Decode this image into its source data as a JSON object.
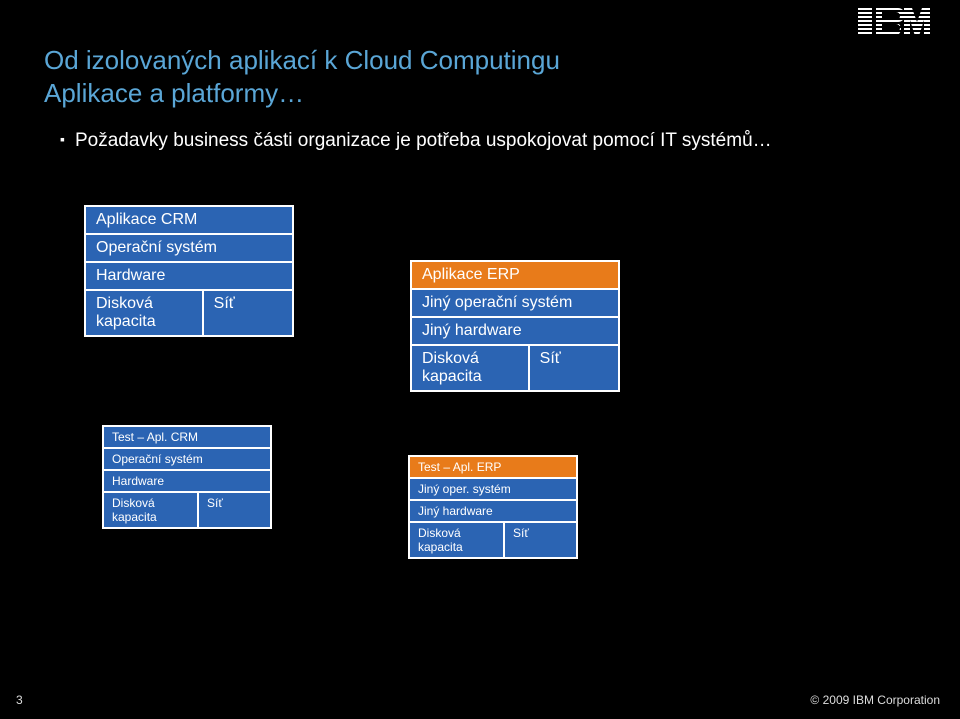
{
  "logo": "IBM",
  "title_line1": "Od izolovaných aplikací k Cloud Computingu",
  "title_line2": "Aplikace a platformy…",
  "bullet": "Požadavky business části organizace je potřeba uspokojovat pomocí IT systémů…",
  "stacks": {
    "crm": {
      "app": "Aplikace CRM",
      "os": "Operační systém",
      "hw": "Hardware",
      "disk": "Disková kapacita",
      "net": "Síť"
    },
    "erp": {
      "app": "Aplikace ERP",
      "os": "Jiný operační systém",
      "hw": "Jiný hardware",
      "disk": "Disková kapacita",
      "net": "Síť"
    },
    "test_crm": {
      "app": "Test – Apl. CRM",
      "os": "Operační systém",
      "hw": "Hardware",
      "disk": "Disková kapacita",
      "net": "Síť"
    },
    "test_erp": {
      "app": "Test – Apl. ERP",
      "os": "Jiný oper. systém",
      "hw": "Jiný hardware",
      "disk": "Disková kapacita",
      "net": "Síť"
    }
  },
  "footer": {
    "page": "3",
    "copyright": "© 2009 IBM Corporation"
  }
}
